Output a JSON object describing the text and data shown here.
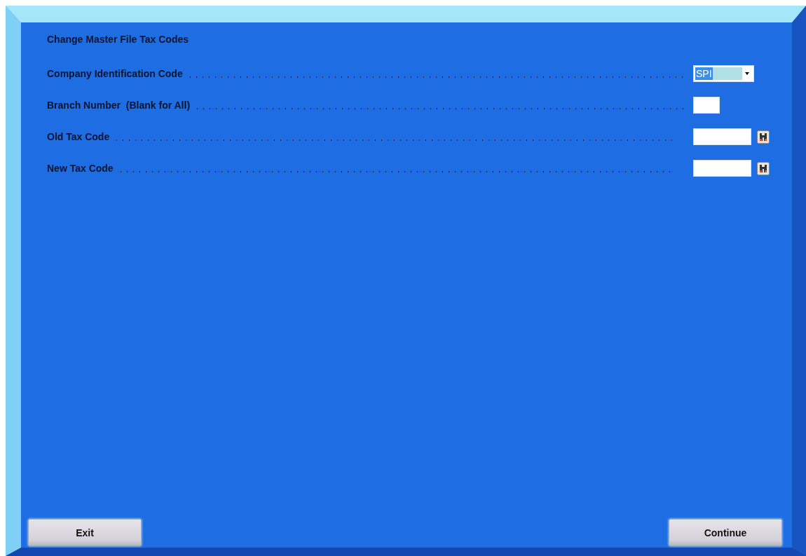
{
  "title": "Change Master File Tax Codes",
  "fields": [
    {
      "label": "Company Identification Code",
      "kind": "dropdown",
      "value": "SPI"
    },
    {
      "label": "Branch Number  (Blank for All)",
      "kind": "short"
    },
    {
      "label": "Old Tax Code",
      "kind": "lookup"
    },
    {
      "label": "New Tax Code",
      "kind": "lookup"
    }
  ],
  "buttons": [
    {
      "label": "Exit"
    },
    {
      "label": "Continue"
    }
  ]
}
